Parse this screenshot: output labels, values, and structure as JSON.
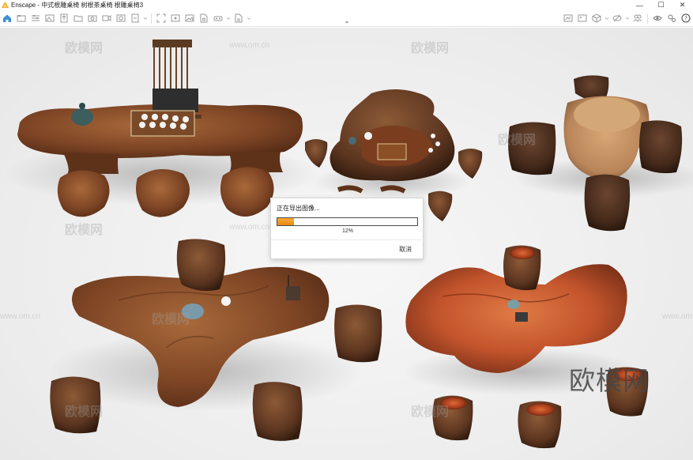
{
  "window": {
    "title": "Enscape - 中式根雕桌椅 树根茶桌椅 根雕桌椅3",
    "minimize_glyph": "—",
    "maximize_glyph": "☐",
    "close_glyph": "✕"
  },
  "toolbar": {
    "left_icons": [
      "home-icon",
      "folder-icon",
      "sliders-icon",
      "image-icon",
      "upload-icon",
      "folder-open-icon",
      "camera-icon",
      "video-icon",
      "panorama-icon",
      "file-export-icon",
      "dropdown-icon"
    ],
    "middle_icons": [
      "capture-icon",
      "screenshot-icon",
      "image-export-icon",
      "file-icon",
      "vr-headset-icon",
      "dropdown-icon",
      "document-icon",
      "dropdown-icon"
    ],
    "right_icons": [
      "gallery-icon",
      "picture-icon",
      "cube-icon",
      "dropdown-icon",
      "brush-icon",
      "dropdown-icon",
      "collaborate-icon",
      "eye-icon",
      "settings-icon",
      "help-icon"
    ],
    "collapse_glyph": "⌃"
  },
  "watermarks": {
    "text": "欧模网",
    "url": "www.om.cn",
    "big": "欧模网"
  },
  "dialog": {
    "title": "正在导出图像...",
    "progress_percent": 12,
    "progress_label": "12%",
    "cancel_label": "取消"
  },
  "colors": {
    "accent_orange": "#f39c1e",
    "wood_dark": "#6b3a20",
    "wood_red": "#c2542c",
    "wood_light": "#b9855a"
  }
}
